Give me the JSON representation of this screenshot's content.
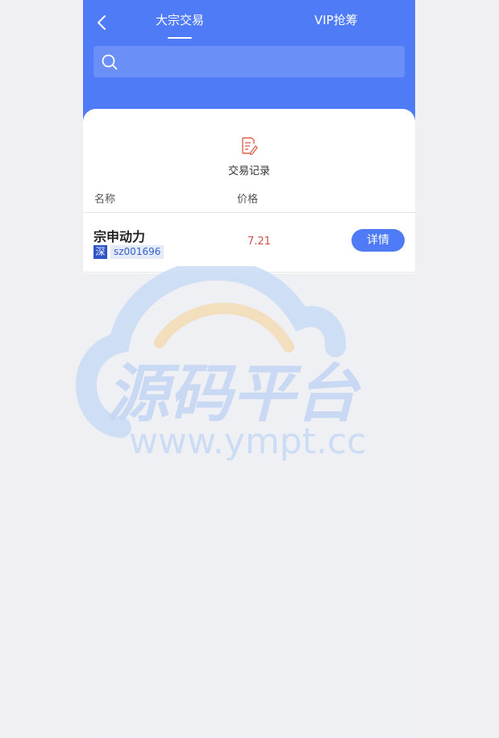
{
  "header": {
    "tabs": [
      {
        "label": "大宗交易",
        "active": true
      },
      {
        "label": "VIP抢筹",
        "active": false
      }
    ]
  },
  "search": {
    "placeholder": "",
    "value": ""
  },
  "record": {
    "label": "交易记录"
  },
  "table": {
    "columns": [
      "名称",
      "价格"
    ],
    "rows": [
      {
        "name": "宗申动力",
        "market": "深",
        "code": "sz001696",
        "price": "7.21",
        "action": "详情"
      }
    ]
  },
  "watermark": {
    "cn": "源码平台",
    "en": "www.ympt.cc"
  },
  "colors": {
    "primary": "#507bf7",
    "price_up": "#d0514e",
    "badge": "#2e55c8",
    "background": "#eff0f4"
  }
}
